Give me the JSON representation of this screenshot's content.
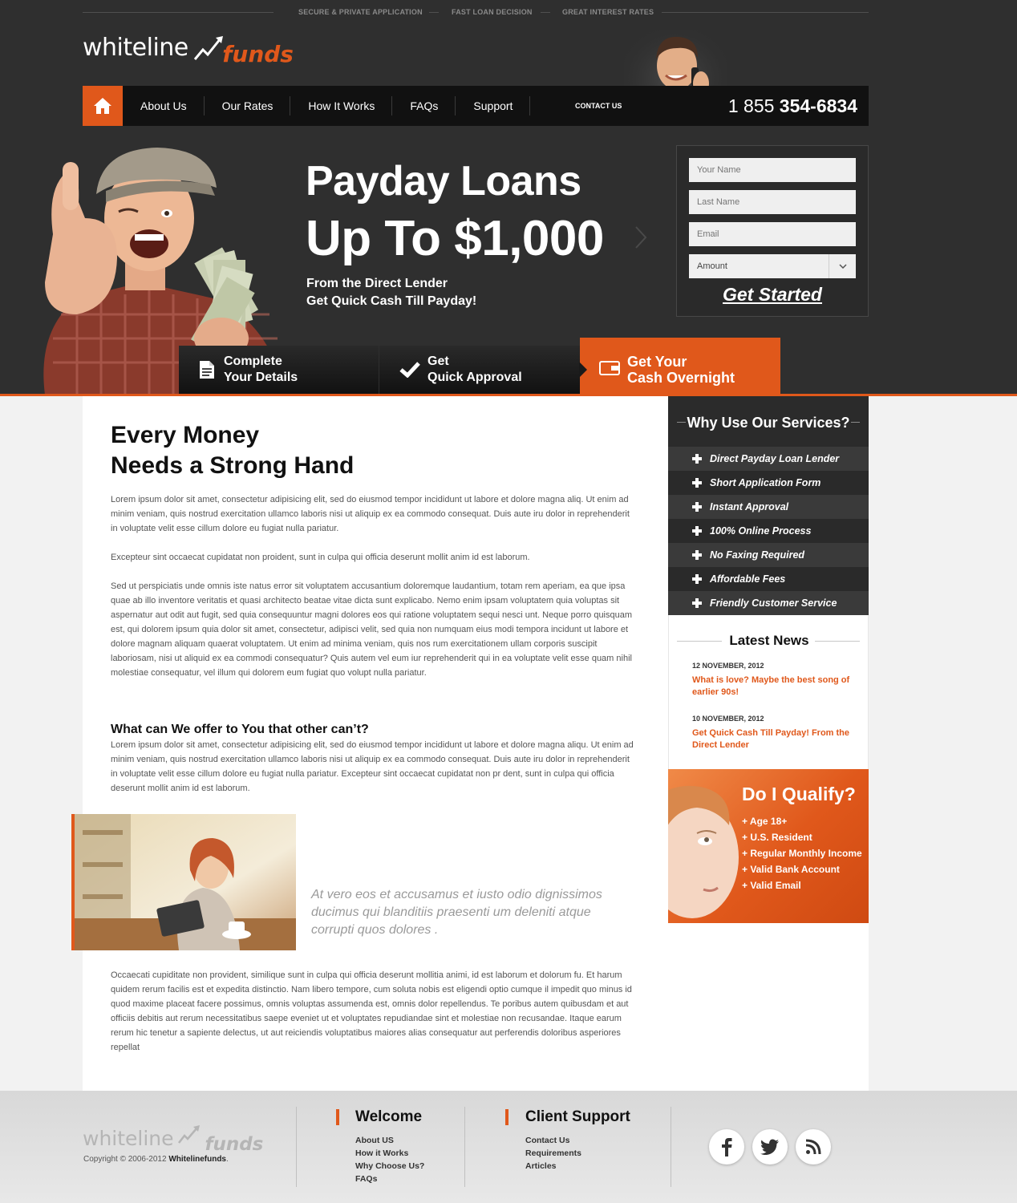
{
  "tagline": [
    "SECURE & PRIVATE APPLICATION",
    "FAST LOAN DECISION",
    "GREAT INTEREST RATES"
  ],
  "logo": {
    "word1": "whiteline",
    "word2": "funds"
  },
  "nav": {
    "items": [
      "About Us",
      "Our Rates",
      "How It Works",
      "FAQs",
      "Support"
    ],
    "contact_label": "CONTACT US",
    "phone_prefix": "1 855",
    "phone_number": "354-6834"
  },
  "hero": {
    "title_line1": "Payday Loans",
    "title_line2": "Up To $1,000",
    "sub_line1": "From the Direct Lender",
    "sub_line2": "Get Quick Cash Till Payday!"
  },
  "form": {
    "name_placeholder": "Your Name",
    "lastname_placeholder": "Last Name",
    "email_placeholder": "Email",
    "amount_placeholder": "Amount",
    "submit_label": "Get Started"
  },
  "steps": [
    {
      "line1": "Complete",
      "line2": "Your Details"
    },
    {
      "line1": "Get",
      "line2": "Quick Approval"
    },
    {
      "line1": "Get Your",
      "line2": "Cash Overnight"
    }
  ],
  "content": {
    "heading_line1": "Every Money",
    "heading_line2": "Needs a Strong Hand",
    "para1": "Lorem ipsum dolor sit amet, consectetur adipisicing elit, sed do eiusmod tempor incididunt ut labore et dolore magna aliq. Ut enim ad minim veniam, quis nostrud exercitation ullamco laboris nisi ut aliquip ex ea commodo consequat. Duis aute iru dolor in reprehenderit in voluptate velit esse cillum dolore eu fugiat nulla pariatur.",
    "para2": "Excepteur sint occaecat cupidatat non proident, sunt in culpa qui officia deserunt mollit anim id est laborum.",
    "para3": "Sed ut perspiciatis unde omnis iste natus error sit voluptatem accusantium doloremque laudantium, totam rem aperiam, ea que ipsa quae ab illo inventore veritatis et quasi architecto beatae vitae dicta sunt explicabo. Nemo enim ipsam voluptatem quia voluptas sit aspernatur aut odit aut fugit, sed quia consequuntur magni dolores eos qui ratione voluptatem sequi nesci unt. Neque porro quisquam est, qui dolorem ipsum quia dolor sit amet, consectetur, adipisci velit, sed quia non numquam eius modi tempora incidunt ut labore et dolore magnam aliquam quaerat voluptatem. Ut enim ad minima veniam, quis nos rum exercitationem ullam corporis suscipit laboriosam, nisi ut aliquid ex ea commodi consequatur? Quis autem vel eum iur reprehenderit qui in ea voluptate velit esse quam nihil molestiae consequatur, vel illum qui dolorem eum fugiat quo volupt nulla pariatur.",
    "subheading": "What can We offer to You that other can’t?",
    "para4": "Lorem ipsum dolor sit amet, consectetur adipisicing elit, sed do eiusmod tempor incididunt ut labore et dolore magna aliqu. Ut enim ad minim veniam, quis nostrud exercitation ullamco laboris nisi ut aliquip ex ea commodo consequat. Duis aute iru dolor in reprehenderit in voluptate velit esse cillum dolore eu fugiat nulla pariatur. Excepteur sint occaecat cupidatat non pr dent, sunt in culpa qui officia deserunt mollit anim id est laborum.",
    "quote": "At vero eos et accusamus et iusto odio dignissimos ducimus qui blanditiis praesenti um deleniti atque corrupti quos dolores .",
    "para5": "Occaecati cupiditate non provident, similique sunt in culpa qui officia deserunt mollitia animi, id est laborum et dolorum fu. Et harum quidem rerum facilis est et expedita distinctio. Nam libero tempore, cum soluta nobis est eligendi optio cumque il impedit quo minus id quod maxime placeat facere possimus, omnis voluptas assumenda est, omnis dolor repellendus. Te poribus autem quibusdam et aut officiis debitis aut rerum necessitatibus saepe eveniet ut et voluptates repudiandae sint et molestiae non recusandae. Itaque earum rerum hic tenetur a sapiente delectus, ut aut reiciendis voluptatibus maiores alias consequatur aut perferendis doloribus asperiores repellat"
  },
  "sidebar": {
    "why_title": "Why Use Our Services?",
    "why_items": [
      "Direct Payday Loan Lender",
      "Short Application Form",
      "Instant Approval",
      "100% Online Process",
      "No Faxing Required",
      "Affordable Fees",
      "Friendly Customer Service"
    ],
    "news_title": "Latest News",
    "news": [
      {
        "date": "12 NOVEMBER, 2012",
        "title": "What is love? Maybe the best song of earlier 90s!"
      },
      {
        "date": "10 NOVEMBER, 2012",
        "title": "Get Quick Cash Till Payday!  From the Direct Lender"
      }
    ],
    "qualify_title": "Do I Qualify?",
    "qualify_items": [
      "+ Age 18+",
      "+ U.S. Resident",
      "+ Regular Monthly Income",
      "+ Valid Bank Account",
      "+ Valid Email"
    ]
  },
  "footer": {
    "logo_word1": "whiteline",
    "logo_word2": "funds",
    "copyright_prefix": "Copyright © 2006-2012",
    "copyright_brand": "Whitelinefunds",
    "copyright_suffix": ".",
    "col1_title": "Welcome",
    "col1_links": [
      "About US",
      "How it Works",
      "Why Choose Us?",
      "FAQs"
    ],
    "col2_title": "Client Support",
    "col2_links": [
      "Contact Us",
      "Requirements",
      "Articles"
    ],
    "social": [
      "facebook-icon",
      "twitter-icon",
      "rss-icon"
    ]
  },
  "colors": {
    "accent": "#e0581b",
    "dark": "#2f2f2f",
    "nav": "#111111"
  }
}
